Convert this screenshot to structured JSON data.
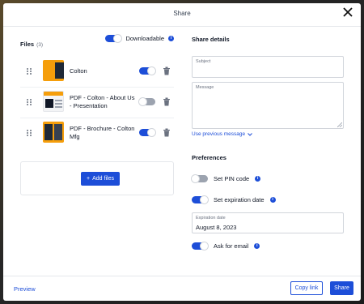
{
  "modal": {
    "title": "Share"
  },
  "files": {
    "heading": "Files",
    "count": "(3)",
    "downloadable_label": "Downloadable",
    "items": [
      {
        "name": "Colton",
        "enabled": true
      },
      {
        "name": "PDF - Colton - About Us - Presentation",
        "enabled": false
      },
      {
        "name": "PDF - Brochure - Colton Mfg",
        "enabled": true
      }
    ],
    "add_label": "Add files"
  },
  "share": {
    "heading": "Share details",
    "subject_label": "Subject",
    "subject_value": "",
    "message_label": "Message",
    "message_value": "",
    "previous_message": "Use previous message"
  },
  "preferences": {
    "heading": "Preferences",
    "pin_label": "Set PIN code",
    "pin_on": false,
    "expiration_label": "Set expiration date",
    "expiration_on": true,
    "expiration_field_label": "Expiration date",
    "expiration_value": "August 8, 2023",
    "email_label": "Ask for email",
    "email_on": true
  },
  "footer": {
    "preview": "Preview",
    "copy_link": "Copy link",
    "share": "Share"
  },
  "colors": {
    "accent": "#1d4ed8",
    "toggle_off": "#9ca3af",
    "thumbnail": "#f59e0b"
  }
}
